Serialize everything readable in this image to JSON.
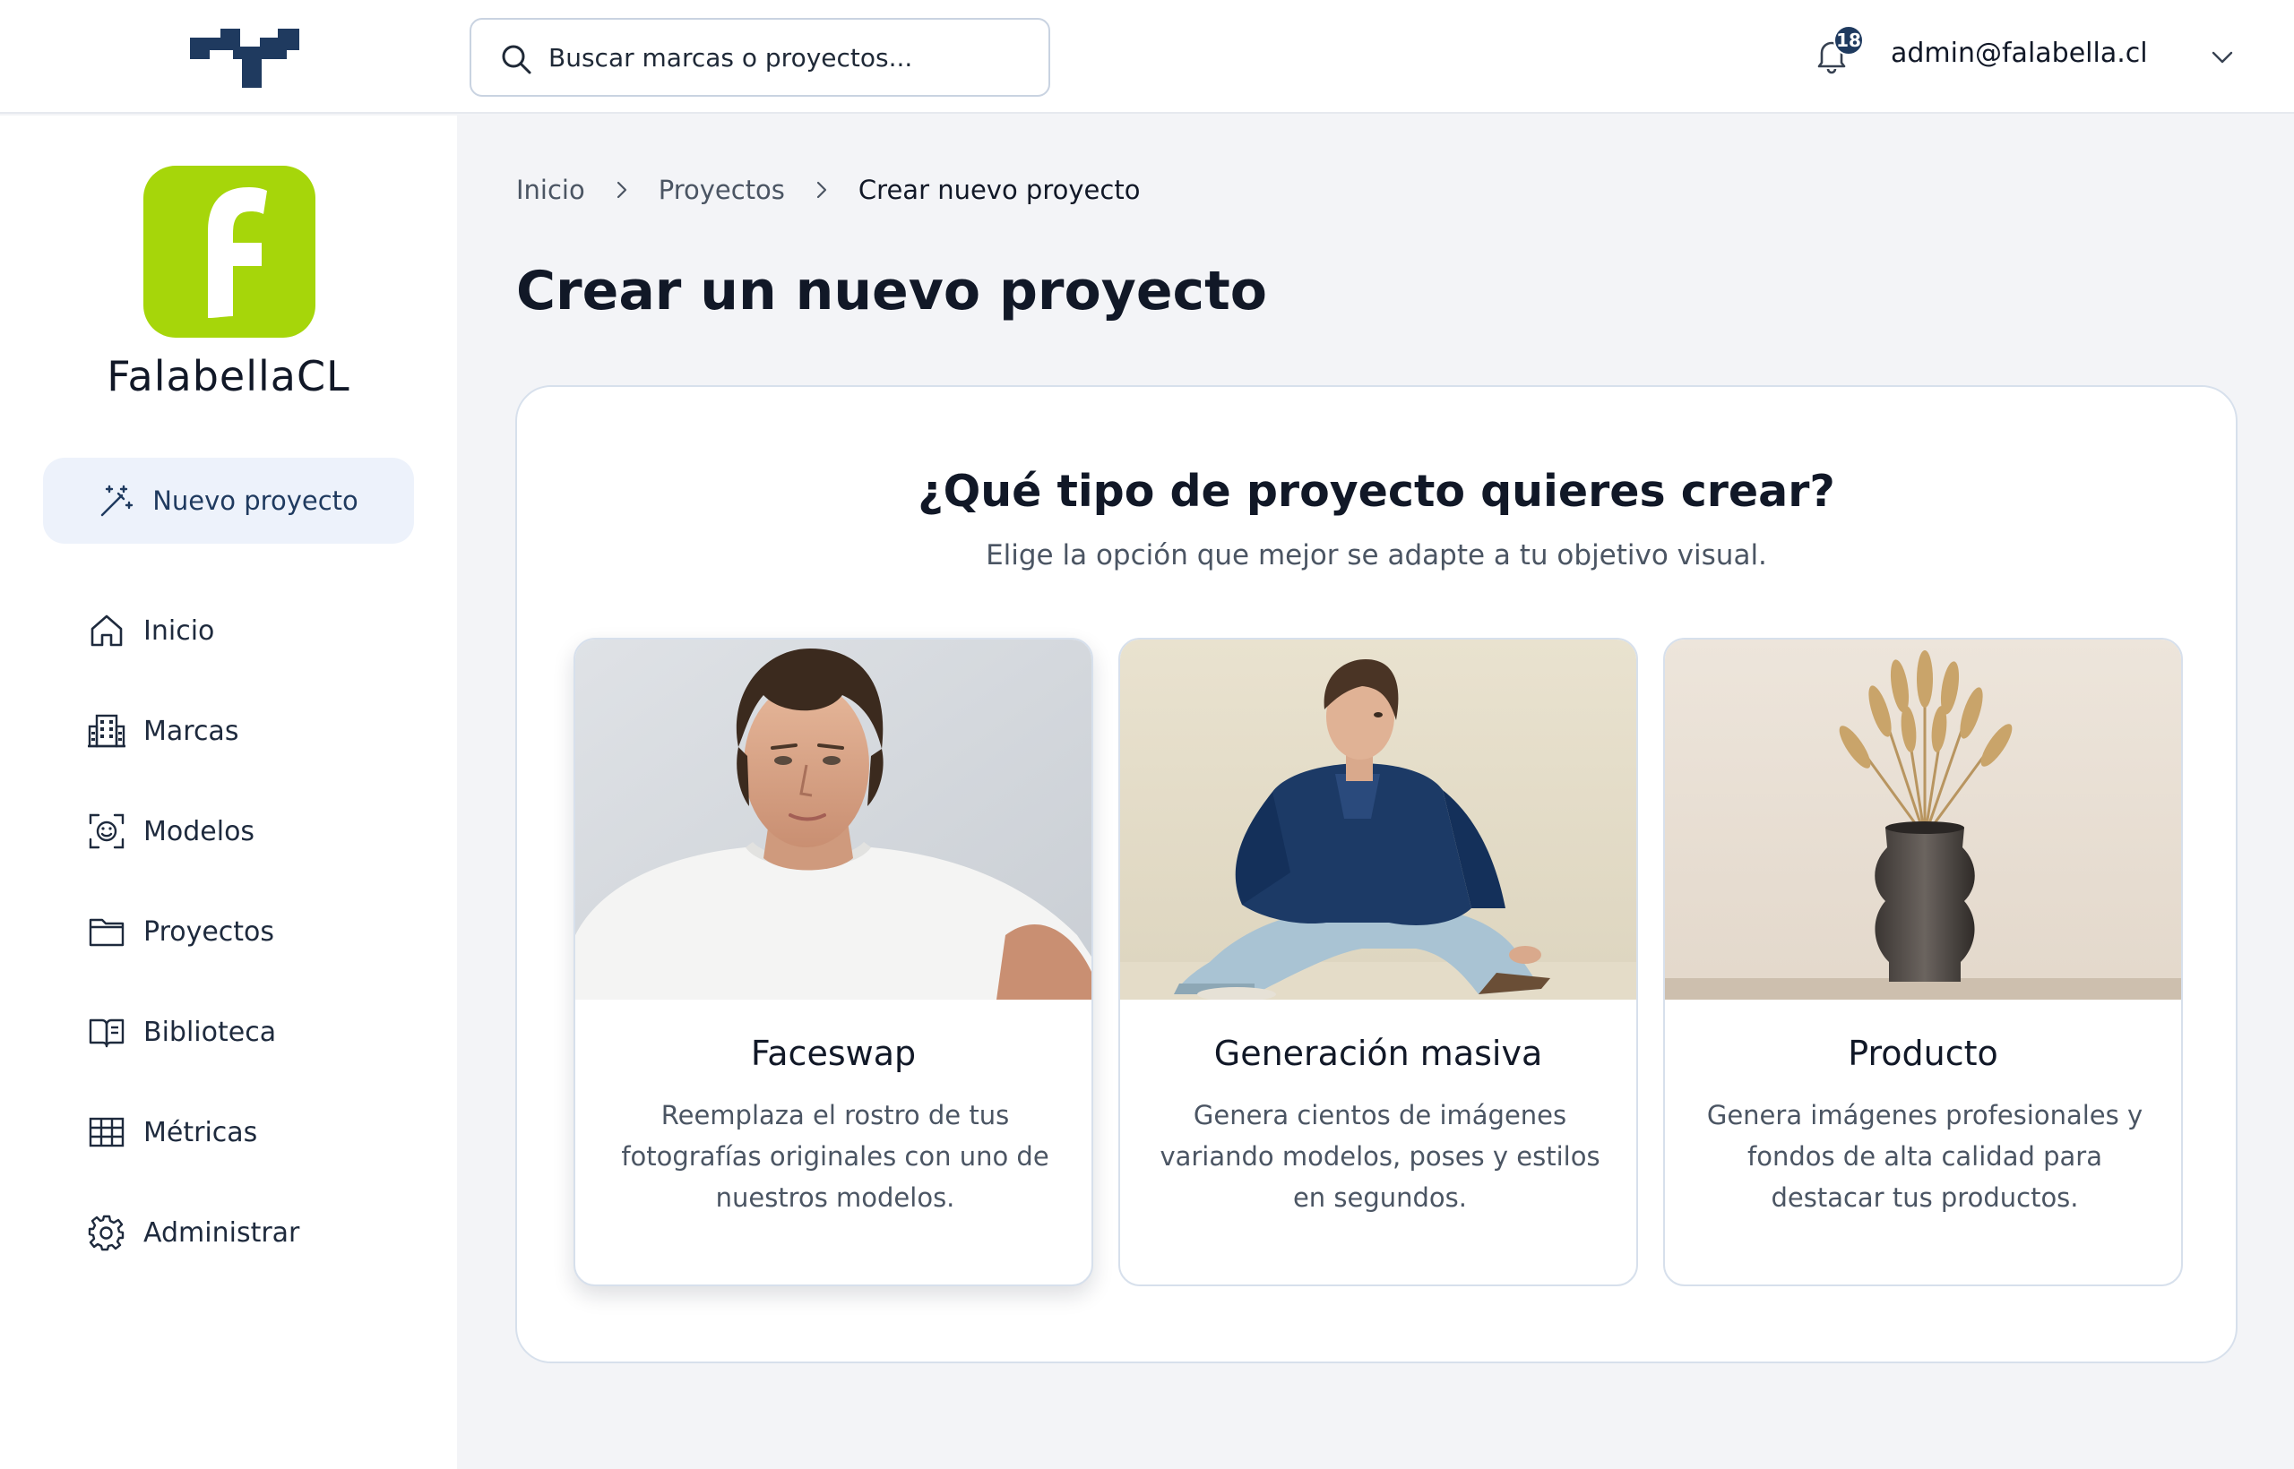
{
  "header": {
    "search_placeholder": "Buscar marcas o proyectos...",
    "notification_count": "18",
    "user_email": "admin@falabella.cl"
  },
  "sidebar": {
    "brand_name": "FalabellaCL",
    "brand_logo_letter": "f",
    "brand_color": "#a6d60a",
    "new_project_label": "Nuevo proyecto",
    "items": [
      {
        "label": "Inicio",
        "icon": "home-icon"
      },
      {
        "label": "Marcas",
        "icon": "building-icon"
      },
      {
        "label": "Modelos",
        "icon": "face-scan-icon"
      },
      {
        "label": "Proyectos",
        "icon": "folder-icon"
      },
      {
        "label": "Biblioteca",
        "icon": "book-icon"
      },
      {
        "label": "Métricas",
        "icon": "table-icon"
      },
      {
        "label": "Administrar",
        "icon": "gear-icon"
      }
    ]
  },
  "breadcrumb": [
    "Inicio",
    "Proyectos",
    "Crear nuevo proyecto"
  ],
  "main": {
    "page_title": "Crear un nuevo proyecto",
    "question": "¿Qué tipo de proyecto quieres crear?",
    "subtitle": "Elige la opción que mejor se adapte a tu objetivo visual.",
    "cards": [
      {
        "title": "Faceswap",
        "description": "Reemplaza el rostro de tus fotografías originales con uno de nuestros modelos.",
        "image": "portrait-young-man-white-tshirt"
      },
      {
        "title": "Generación masiva",
        "description": "Genera cientos de imágenes variando modelos, poses y estilos en segundos.",
        "image": "seated-man-denim-outfit"
      },
      {
        "title": "Producto",
        "description": "Genera imágenes profesionales y fondos de alta calidad para destacar tus productos.",
        "image": "vase-with-dried-wheat"
      }
    ]
  },
  "colors": {
    "accent": "#1f3a5f",
    "background": "#f3f4f7",
    "border": "#d7e0ec"
  }
}
